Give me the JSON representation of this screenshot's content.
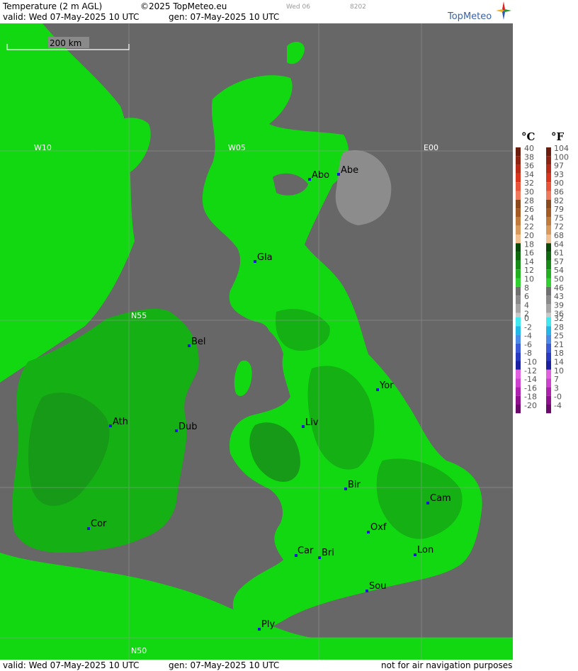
{
  "header": {
    "title": "Temperature (2 m AGL)",
    "copyright": "©2025 TopMeteo.eu",
    "day_code": "Wed 06",
    "run_code": "8202",
    "valid": "valid:  Wed  07-May-2025  10 UTC",
    "gen": "gen: 07-May-2025 10 UTC",
    "brand": "TopMeteo"
  },
  "footer": {
    "valid": "valid:  Wed  07-May-2025  10 UTC",
    "gen": "gen: 07-May-2025 10 UTC",
    "disclaimer": "not for air navigation purposes"
  },
  "scale_bar": {
    "label": "200 km"
  },
  "grid_labels": {
    "w10": "W10",
    "w05": "W05",
    "e00": "E00",
    "n55": "N55",
    "n50": "N50"
  },
  "cities": [
    {
      "key": "abo",
      "name": "Abo"
    },
    {
      "key": "abe",
      "name": "Abe"
    },
    {
      "key": "gla",
      "name": "Gla"
    },
    {
      "key": "bel",
      "name": "Bel"
    },
    {
      "key": "yor",
      "name": "Yor"
    },
    {
      "key": "ath",
      "name": "Ath"
    },
    {
      "key": "dub",
      "name": "Dub"
    },
    {
      "key": "liv",
      "name": "Liv"
    },
    {
      "key": "bir",
      "name": "Bir"
    },
    {
      "key": "cam",
      "name": "Cam"
    },
    {
      "key": "cor",
      "name": "Cor"
    },
    {
      "key": "oxf",
      "name": "Oxf"
    },
    {
      "key": "car",
      "name": "Car"
    },
    {
      "key": "bri",
      "name": "Bri"
    },
    {
      "key": "lon",
      "name": "Lon"
    },
    {
      "key": "sou",
      "name": "Sou"
    },
    {
      "key": "ply",
      "name": "Ply"
    }
  ],
  "legend": {
    "unit_c": "°C",
    "unit_f": "°F",
    "celsius_warm": [
      "40",
      "38",
      "36",
      "34",
      "32",
      "30",
      "28",
      "26",
      "24",
      "22",
      "20",
      "18",
      "16",
      "14",
      "12",
      "10",
      "8",
      "6",
      "4",
      "2"
    ],
    "fahrenheit_warm": [
      "104",
      "100",
      "97",
      "93",
      "90",
      "86",
      "82",
      "79",
      "75",
      "72",
      "68",
      "64",
      "61",
      "57",
      "54",
      "50",
      "46",
      "43",
      "39",
      "36"
    ],
    "warm_colors": [
      "#6b1e0e",
      "#8f2311",
      "#b82a15",
      "#d8351c",
      "#e8543a",
      "#f07a5e",
      "#8a4a1e",
      "#a55a24",
      "#c07a3a",
      "#d89a5a",
      "#f0c090",
      "#0a4a0a",
      "#0f6a0f",
      "#178a17",
      "#20b020",
      "#30d030",
      "#707070",
      "#8a8a8a",
      "#a5a5a5",
      "#c8c8c8"
    ],
    "celsius_cold": [
      "0",
      "-2",
      "-4",
      "-6",
      "-8",
      "-10",
      "-12",
      "-14",
      "-16",
      "-18",
      "-20"
    ],
    "fahrenheit_cold": [
      "32",
      "28",
      "25",
      "21",
      "18",
      "14",
      "10",
      "7",
      "3",
      "-0",
      "-4"
    ],
    "cold_colors": [
      "#40e8f0",
      "#20b8e8",
      "#4a8ae8",
      "#3a5ad8",
      "#2a3ac0",
      "#1a20a0",
      "#e060e0",
      "#d040d0",
      "#b020b0",
      "#901090",
      "#6a0a6a"
    ],
    "colors": {
      "sea": "#676767",
      "land_12": "#11d811",
      "land_10": "#10c810",
      "land_14": "#14b014",
      "land_16": "#179a17",
      "cold_patch": "#8c8c8c"
    }
  }
}
